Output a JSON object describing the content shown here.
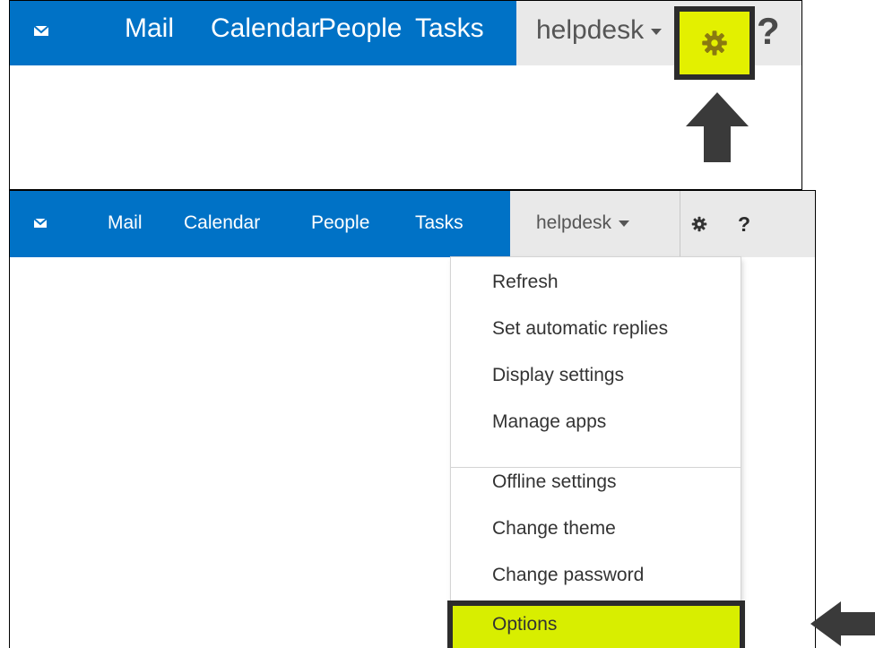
{
  "top_panel": {
    "nav": [
      "Mail",
      "Calendar",
      "People",
      "Tasks"
    ],
    "user": "helpdesk",
    "help": "?"
  },
  "bottom_panel": {
    "nav": [
      "Mail",
      "Calendar",
      "People",
      "Tasks"
    ],
    "user": "helpdesk",
    "help": "?",
    "menu_items": [
      "Refresh",
      "Set automatic replies",
      "Display settings",
      "Manage apps",
      "Offline settings",
      "Change theme",
      "Change password",
      "Options"
    ]
  },
  "colors": {
    "accent_blue": "#0072c6",
    "highlight": "#e3f000",
    "bar_grey": "#e9e9e9"
  },
  "icons": [
    "mail-icon",
    "gear-icon",
    "help-icon",
    "arrow-up-icon",
    "arrow-left-icon"
  ]
}
